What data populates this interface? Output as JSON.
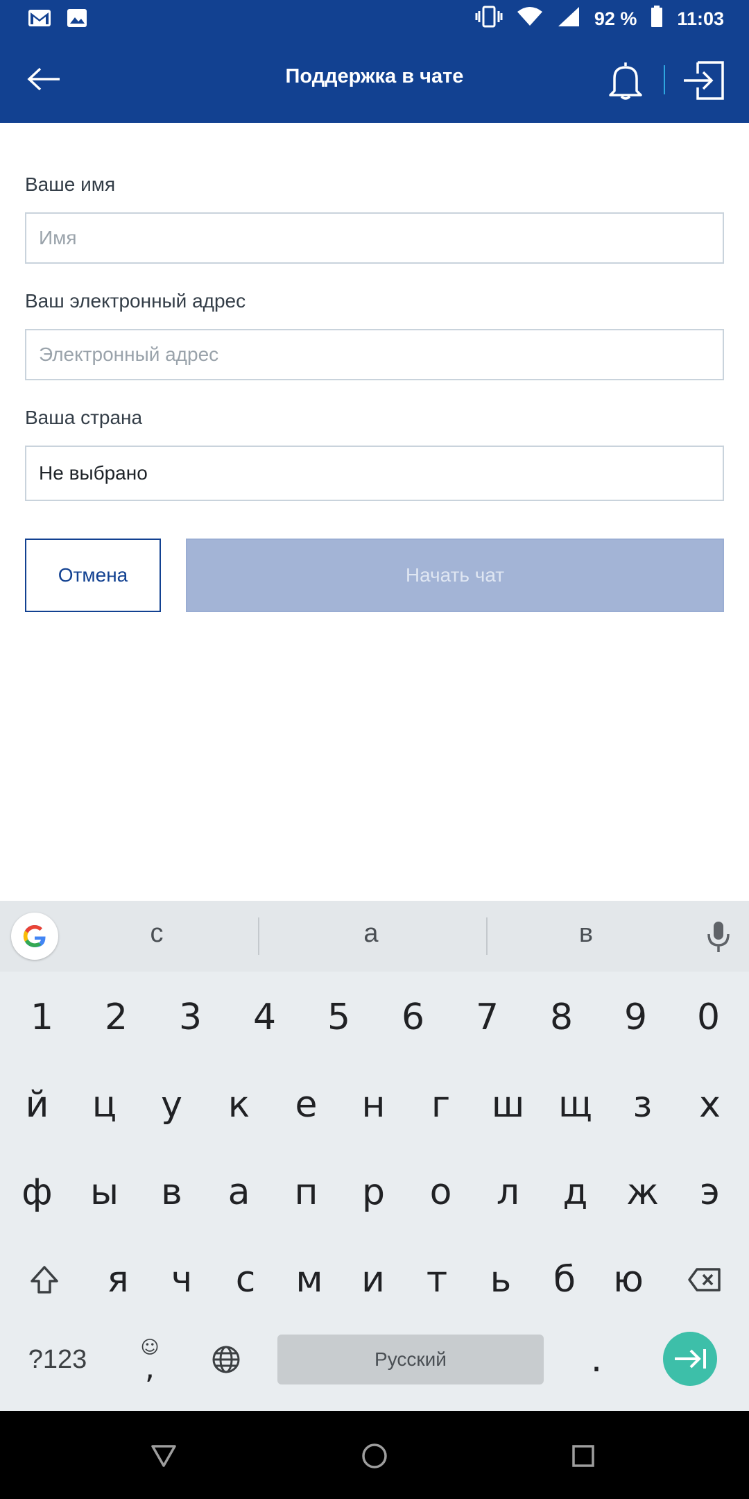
{
  "status_bar": {
    "battery_text": "92 %",
    "time": "11:03",
    "left_icons": [
      "gmail-icon",
      "gallery-icon"
    ],
    "right_icons": [
      "vibrate-icon",
      "wifi-icon",
      "signal-icon",
      "battery-icon"
    ]
  },
  "header": {
    "title": "Поддержка в чате",
    "background": "#124191",
    "divider_color": "#2ea7e0"
  },
  "form": {
    "name_label": "Ваше имя",
    "name_placeholder": "Имя",
    "email_label": "Ваш электронный адрес",
    "email_placeholder": "Электронный адрес",
    "country_label": "Ваша страна",
    "country_value": "Не выбрано",
    "cancel_label": "Отмена",
    "start_label": "Начать чат"
  },
  "keyboard": {
    "suggestions": [
      "с",
      "а",
      "в"
    ],
    "row_numbers": [
      "1",
      "2",
      "3",
      "4",
      "5",
      "6",
      "7",
      "8",
      "9",
      "0"
    ],
    "row_1": [
      "й",
      "ц",
      "у",
      "к",
      "е",
      "н",
      "г",
      "ш",
      "щ",
      "з",
      "х"
    ],
    "row_2": [
      "ф",
      "ы",
      "в",
      "а",
      "п",
      "р",
      "о",
      "л",
      "д",
      "ж",
      "э"
    ],
    "row_3": [
      "я",
      "ч",
      "с",
      "м",
      "и",
      "т",
      "ь",
      "б",
      "ю"
    ],
    "symbols_key": "?123",
    "comma_key": ",",
    "emoji_hint": "☺",
    "period_key": ".",
    "space_label": "Русский",
    "enter_color": "#3dbfa9"
  }
}
